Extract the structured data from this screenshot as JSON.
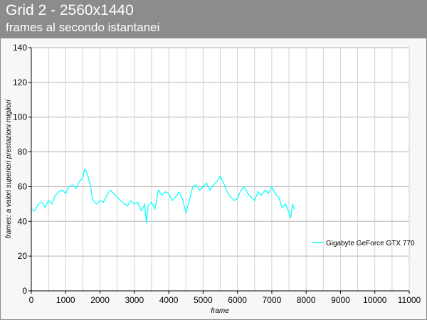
{
  "chart_data": {
    "type": "line",
    "title": "Grid 2 - 2560x1440",
    "subtitle": "frames al secondo istantanei",
    "xlabel": "frame",
    "ylabel": "frames: a valori superiori prestazioni migliori",
    "xlim": [
      0,
      11000
    ],
    "ylim": [
      0,
      140
    ],
    "x_ticks": [
      "0",
      "1000",
      "2000",
      "3000",
      "4000",
      "5000",
      "6000",
      "7000",
      "8000",
      "9000",
      "10000",
      "11000"
    ],
    "y_ticks": [
      "0",
      "20",
      "40",
      "60",
      "80",
      "100",
      "120",
      "140"
    ],
    "grid": true,
    "legend_position": "right",
    "series": [
      {
        "name": "Gigabyte GeForce GTX 770",
        "color": "#00ffff",
        "x": [
          0,
          100,
          200,
          300,
          400,
          500,
          600,
          700,
          800,
          900,
          1000,
          1100,
          1200,
          1300,
          1400,
          1500,
          1550,
          1600,
          1650,
          1700,
          1800,
          1900,
          2000,
          2100,
          2200,
          2300,
          2400,
          2500,
          2600,
          2700,
          2800,
          2900,
          3000,
          3100,
          3200,
          3300,
          3350,
          3400,
          3500,
          3600,
          3700,
          3800,
          3900,
          4000,
          4100,
          4200,
          4300,
          4400,
          4500,
          4600,
          4700,
          4800,
          4900,
          5000,
          5100,
          5200,
          5300,
          5400,
          5500,
          5600,
          5700,
          5800,
          5900,
          6000,
          6100,
          6200,
          6300,
          6400,
          6500,
          6600,
          6700,
          6800,
          6900,
          7000,
          7100,
          7200,
          7300,
          7400,
          7500,
          7550,
          7600,
          7650
        ],
        "values": [
          47,
          46,
          50,
          51,
          48,
          52,
          50,
          55,
          57,
          58,
          56,
          60,
          61,
          59,
          63,
          65,
          70,
          69,
          66,
          62,
          52,
          50,
          52,
          51,
          55,
          58,
          56,
          54,
          52,
          50,
          49,
          52,
          50,
          51,
          46,
          50,
          39,
          49,
          51,
          47,
          58,
          55,
          57,
          56,
          52,
          54,
          57,
          53,
          45,
          52,
          60,
          61,
          58,
          60,
          62,
          58,
          61,
          63,
          66,
          62,
          57,
          54,
          52,
          53,
          58,
          60,
          56,
          54,
          52,
          57,
          55,
          58,
          56,
          60,
          56,
          54,
          48,
          50,
          45,
          42,
          50,
          47
        ]
      }
    ]
  }
}
